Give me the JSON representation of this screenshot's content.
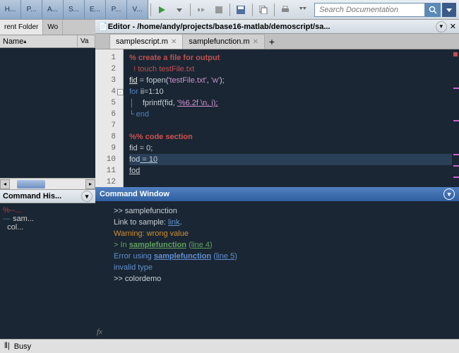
{
  "toolbar": {
    "tabs": [
      "H...",
      "P...",
      "A...",
      "S...",
      "E...",
      "P...",
      "V..."
    ],
    "search_placeholder": "Search Documentation"
  },
  "folder": {
    "tab1": "rent Folder",
    "tab2": "Wo",
    "col_name": "Name",
    "col_va": "Va"
  },
  "history": {
    "title": "Command His...",
    "items": [
      "%--...",
      "sam...",
      "col..."
    ]
  },
  "editor": {
    "title": "Editor - /home/andy/projects/base16-matlab/demoscript/sa...",
    "tabs": [
      "samplescript.m",
      "samplefunction.m"
    ],
    "lines": {
      "l1": "% create a file for output",
      "l2": "! touch testFile.txt",
      "l3a": "fid",
      "l3b": " = fopen(",
      "l3c": "'testFile.txt'",
      "l3d": ", ",
      "l3e": "'w'",
      "l3f": ");",
      "l4a": "for",
      "l4b": " ii=1:10",
      "l5a": "    fprintf(fid, ",
      "l5b": "'%6.2f \\n, i);",
      "l6": "end",
      "l8": "%% code section",
      "l9": "fid = 0;",
      "l10a": "fod",
      "l10b": " = 10",
      "l11": "fod"
    }
  },
  "command": {
    "title": "Command Window",
    "l1": ">> samplefunction",
    "l2a": "Link to sample: ",
    "l2b": "link",
    "l2c": ".",
    "l3": "Warning: wrong value",
    "l4a": "> In ",
    "l4b": "samplefunction",
    "l4c": " (",
    "l4d": "line 4",
    "l4e": ")",
    "l5a": "Error using ",
    "l5b": "samplefunction",
    "l5c": " (",
    "l5d": "line 5",
    "l5e": ")",
    "l6": "invalid type",
    "l7": ">> colordemo"
  },
  "status": {
    "text": "Busy"
  }
}
